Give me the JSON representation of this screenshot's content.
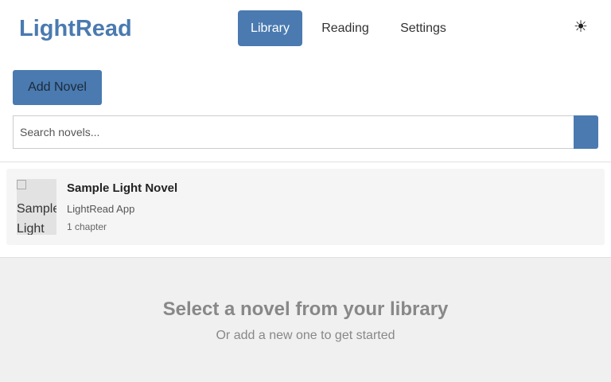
{
  "app": {
    "title": "LightRead"
  },
  "nav": {
    "library": "Library",
    "reading": "Reading",
    "settings": "Settings",
    "active": "Library"
  },
  "theme_toggle": {
    "icon": "sun-icon",
    "glyph": "☀"
  },
  "library": {
    "add_button": "Add Novel",
    "search": {
      "placeholder": "Search novels...",
      "value": "",
      "button_glyph": ""
    },
    "novels": [
      {
        "cover_alt": "Sample Light",
        "title": "Sample Light Novel",
        "author": "LightRead App",
        "chapters": "1 chapter"
      }
    ]
  },
  "empty_state": {
    "title": "Select a novel from your library",
    "subtitle": "Or add a new one to get started"
  },
  "colors": {
    "accent": "#4a7ab0",
    "background": "#f0f0f0"
  }
}
